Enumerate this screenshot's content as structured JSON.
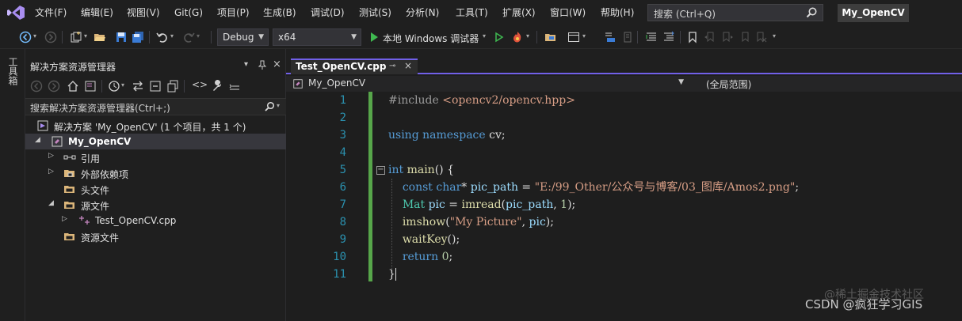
{
  "menu": {
    "items": [
      "文件(F)",
      "编辑(E)",
      "视图(V)",
      "Git(G)",
      "项目(P)",
      "生成(B)",
      "调试(D)",
      "测试(S)",
      "分析(N)",
      "工具(T)",
      "扩展(X)",
      "窗口(W)",
      "帮助(H)"
    ],
    "search_label": "搜索 (Ctrl+Q)",
    "solution_name": "My_OpenCV"
  },
  "toolbar": {
    "config": "Debug",
    "platform": "x64",
    "run_label": "本地 Windows 调试器"
  },
  "toolbox": {
    "label": "工具箱"
  },
  "solution_explorer": {
    "title": "解决方案资源管理器",
    "search_placeholder": "搜索解决方案资源管理器(Ctrl+;)",
    "tree": [
      {
        "label": "解决方案 'My_OpenCV' (1 个项目，共 1 个)",
        "icon": "solution-icon",
        "expander": ""
      },
      {
        "label": "My_OpenCV",
        "icon": "project-icon",
        "expander": "◢",
        "bold": true,
        "selected": true
      },
      {
        "label": "引用",
        "icon": "references-icon",
        "expander": "▷"
      },
      {
        "label": "外部依赖项",
        "icon": "external-deps-icon",
        "expander": "▷"
      },
      {
        "label": "头文件",
        "icon": "folder-icon",
        "expander": ""
      },
      {
        "label": "源文件",
        "icon": "folder-icon",
        "expander": "◢"
      },
      {
        "label": "Test_OpenCV.cpp",
        "icon": "cpp-file-icon",
        "expander": "▷"
      },
      {
        "label": "资源文件",
        "icon": "folder-icon",
        "expander": ""
      }
    ]
  },
  "editor": {
    "tab_name": "Test_OpenCV.cpp",
    "nav_scope": "My_OpenCV",
    "nav_member": "(全局范围)",
    "line_numbers": [
      "1",
      "2",
      "3",
      "4",
      "5",
      "6",
      "7",
      "8",
      "9",
      "10",
      "11"
    ]
  },
  "watermark": {
    "main": "CSDN @疯狂学习GIS",
    "faint": "@稀土掘金技术社区"
  },
  "colors": {
    "accent": "#7160e8",
    "change_bar": "#57a64a",
    "line_number": "#2b91af"
  }
}
